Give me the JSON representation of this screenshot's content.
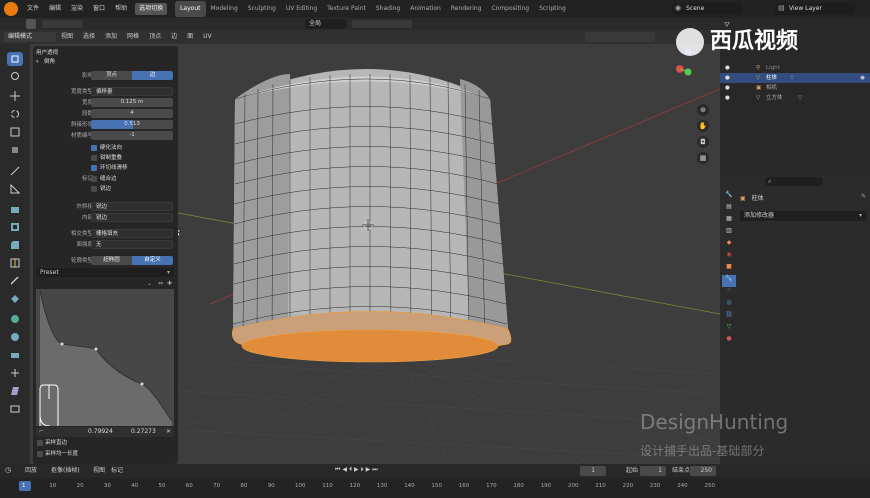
{
  "topbar": {
    "menus": [
      "文件",
      "编辑",
      "渲染",
      "窗口",
      "帮助"
    ],
    "mode_chip": "选项切换",
    "workspaces": [
      "Layout",
      "Modeling",
      "Sculpting",
      "UV Editing",
      "Texture Paint",
      "Shading",
      "Animation",
      "Rendering",
      "Compositing",
      "Scripting"
    ],
    "active_workspace": "Layout",
    "scene": "Scene",
    "view_layer": "View Layer"
  },
  "header": {
    "mode": "编辑模式",
    "menus": [
      "视图",
      "选择",
      "添加",
      "网格",
      "顶点",
      "边",
      "面",
      "UV"
    ],
    "transform": "全局"
  },
  "operator_panel": {
    "title": "用户透视",
    "subtitle": "倒角",
    "affect_label": "影响",
    "affect_options": [
      "顶点",
      "边"
    ],
    "affect_selected": "边",
    "width_type_label": "宽度类型",
    "width_type": "偏移量",
    "width_label": "宽度",
    "width": "0.125 m",
    "segments_label": "段数",
    "segments": "4",
    "profile_label": "斜接形状",
    "profile": "0.513",
    "material_label": "材质编号",
    "material": "-1",
    "harden_normals": "硬化法向",
    "clamp_overlap": "钳制重叠",
    "loop_slide": "环切线滑移",
    "mark_label": "标记",
    "mark_seams": "缝合边",
    "mark_sharp": "锐边",
    "miter_outer_label": "外斜接",
    "miter_outer": "锐边",
    "miter_inner_label": "内部",
    "miter_inner": "锐边",
    "intersection_label": "相交类型",
    "intersection": "栅格填充",
    "face_strength_label": "面强度",
    "face_strength": "无",
    "profile_type_label": "轮廓类型",
    "profile_types": [
      "超椭圆",
      "自定义"
    ],
    "profile_type_selected": "自定义",
    "preset_label": "Preset",
    "curve_x": "0.79924",
    "curve_y": "0.27273",
    "sample_straight": "采样直边",
    "sample_even": "采样均一长度"
  },
  "outliner": {
    "items": [
      {
        "name": "Light",
        "selected": false
      },
      {
        "name": "柱体",
        "selected": true
      },
      {
        "name": "相机",
        "selected": false
      },
      {
        "name": "立方体",
        "selected": false
      }
    ]
  },
  "properties": {
    "object_name": "柱体",
    "add_modifier": "添加修改器"
  },
  "timeline": {
    "menus": [
      "回放",
      "抠像(插帧)",
      "视图",
      "标记"
    ],
    "current_frame": "1",
    "start_label": "起始",
    "start": "1",
    "end_label": "结束点",
    "end": "250",
    "ticks": [
      "1",
      "10",
      "20",
      "30",
      "40",
      "50",
      "60",
      "70",
      "80",
      "90",
      "100",
      "110",
      "120",
      "130",
      "140",
      "150",
      "160",
      "170",
      "180",
      "190",
      "200",
      "210",
      "220",
      "230",
      "240",
      "250"
    ]
  },
  "watermark": {
    "logo_text": "西瓜视频",
    "brand": "DesignHunting",
    "caption": "设计捕手出品-基础部分"
  }
}
